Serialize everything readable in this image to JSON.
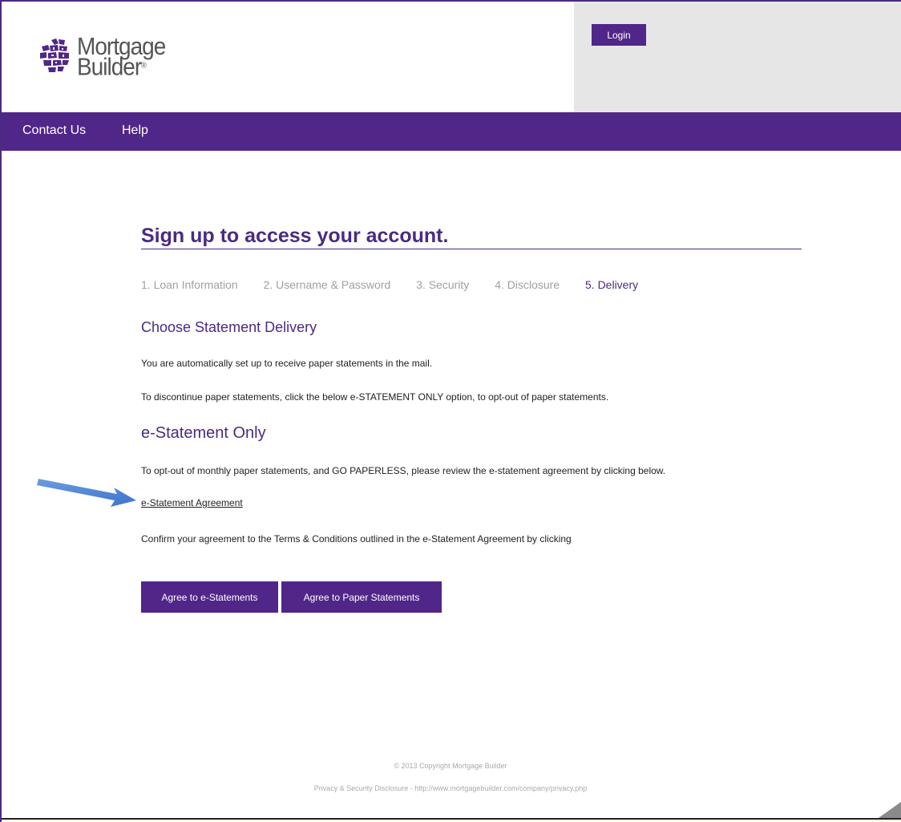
{
  "header": {
    "logo_line1": "Mortgage",
    "logo_line2": "Builder",
    "logo_reg": "®",
    "login_label": "Login"
  },
  "nav": {
    "contact_us": "Contact Us",
    "help": "Help"
  },
  "main": {
    "title": "Sign up to access your account.",
    "steps": [
      {
        "label": "1. Loan Information"
      },
      {
        "label": "2. Username & Password"
      },
      {
        "label": "3. Security"
      },
      {
        "label": "4. Disclosure"
      },
      {
        "label": "5. Delivery"
      }
    ],
    "choose_heading": "Choose Statement Delivery",
    "paper_note": "You are automatically set up to receive paper statements in the mail.",
    "discontinue_note": "To discontinue paper statements, click the below e-STATEMENT ONLY option, to opt-out of paper statements.",
    "estatement_heading": "e-Statement Only",
    "optout_note": "To opt-out of monthly paper statements, and GO PAPERLESS, please review the e-statement agreement by clicking below.",
    "agreement_link": "e-Statement Agreement",
    "confirm_note": "Confirm your agreement to the Terms & Conditions outlined in the e-Statement Agreement by clicking",
    "agree_estatements_label": "Agree to e-Statements",
    "agree_paper_label": "Agree to Paper Statements"
  },
  "footer": {
    "copyright": "© 2013 Copyright Mortgage Builder",
    "privacy": "Privacy & Security Disclosure - http://www.mortgagebuilder.com/company/privacy.php"
  },
  "colors": {
    "brand_purple": "#512689",
    "heading_purple": "#4b2a82",
    "annotation_arrow": "#4a7fd4"
  }
}
